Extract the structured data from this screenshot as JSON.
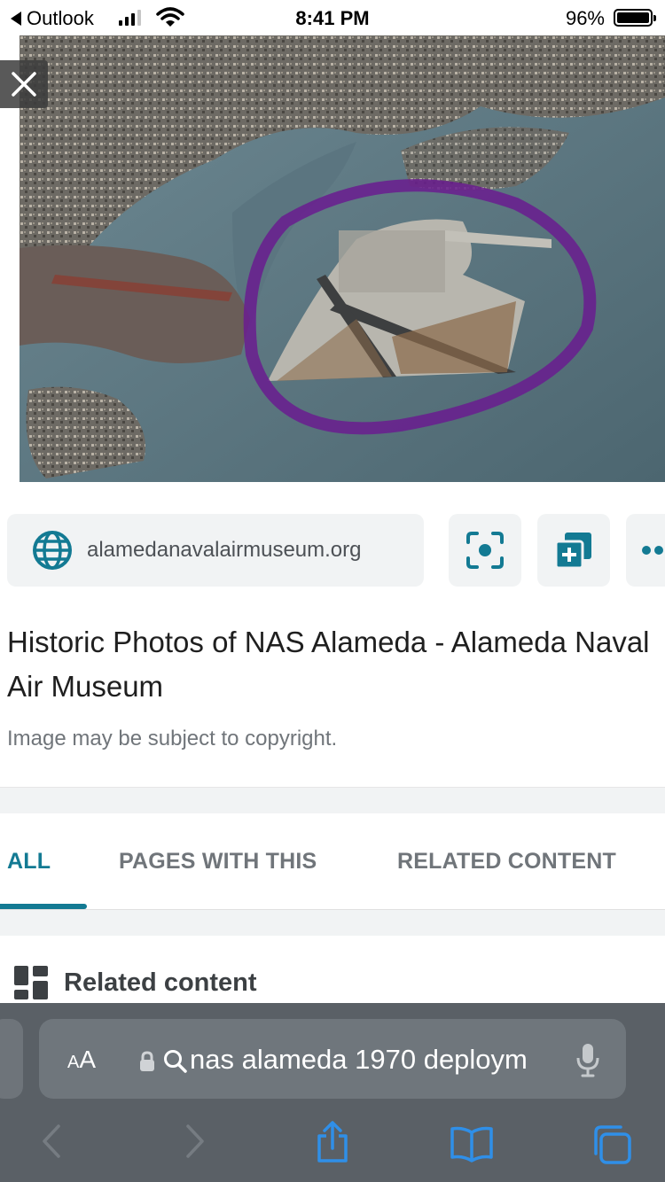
{
  "status_bar": {
    "back_app": "Outlook",
    "time": "8:41 PM",
    "battery_percent": "96%",
    "signal_bars_filled": 3,
    "signal_bars_total": 4
  },
  "image_viewer": {
    "close_icon": "close-icon",
    "image_highlight_color": "#6a1c8f"
  },
  "source": {
    "domain": "alamedanavalairmuseum.org",
    "globe_icon": "globe-icon",
    "actions": [
      "lens-icon",
      "add-to-collection-icon",
      "more-icon"
    ]
  },
  "result": {
    "title": "Historic Photos of NAS Alameda - Alameda Naval Air Museum",
    "copyright_notice": "Image may be subject to copyright."
  },
  "tabs": {
    "items": [
      {
        "label": "ALL",
        "active": true
      },
      {
        "label": "PAGES WITH THIS",
        "active": false
      },
      {
        "label": "RELATED CONTENT",
        "active": false
      }
    ]
  },
  "related": {
    "heading": "Related content",
    "icon": "grid-icon"
  },
  "safari": {
    "text_size_button": "AA",
    "address_text": "nas alameda 1970 deploym",
    "toolbar_icons": [
      "back-icon",
      "forward-icon",
      "share-icon",
      "bookmarks-icon",
      "tabs-icon"
    ]
  },
  "colors": {
    "accent": "#137a93",
    "toolbar_bg": "#5a6066",
    "address_bg": "#6f767c"
  }
}
